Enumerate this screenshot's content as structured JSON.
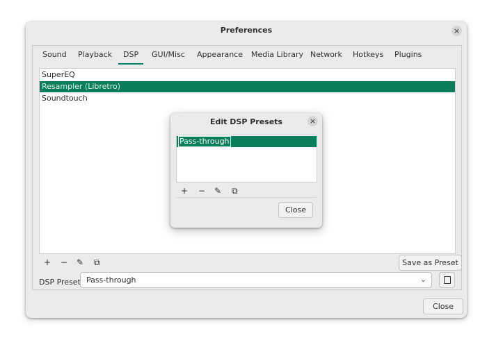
{
  "window": {
    "title": "Preferences",
    "close_glyph": "×"
  },
  "tabs": [
    {
      "label": "Sound"
    },
    {
      "label": "Playback"
    },
    {
      "label": "DSP",
      "active": true
    },
    {
      "label": "GUI/Misc"
    },
    {
      "label": "Appearance"
    },
    {
      "label": "Media Library"
    },
    {
      "label": "Network"
    },
    {
      "label": "Hotkeys"
    },
    {
      "label": "Plugins"
    }
  ],
  "dsp": {
    "items": [
      {
        "label": "SuperEQ"
      },
      {
        "label": "Resampler (Libretro)",
        "selected": true
      },
      {
        "label": "Soundtouch"
      }
    ],
    "toolbar": {
      "add": "+",
      "remove": "−",
      "configure": "✎",
      "copy": "⧉"
    },
    "save_preset_label": "Save as Preset",
    "preset_label": "DSP Preset:",
    "preset_value": "Pass-through",
    "chevron": "⌄"
  },
  "close_label": "Close",
  "dialog": {
    "title": "Edit DSP Presets",
    "close_glyph": "×",
    "items": [
      {
        "label": "Pass-through"
      }
    ],
    "toolbar": {
      "add": "+",
      "remove": "−",
      "configure": "✎",
      "copy": "⧉"
    },
    "close_label": "Close"
  },
  "colors": {
    "accent": "#0a7d5a",
    "window_bg": "#ebebeb"
  }
}
